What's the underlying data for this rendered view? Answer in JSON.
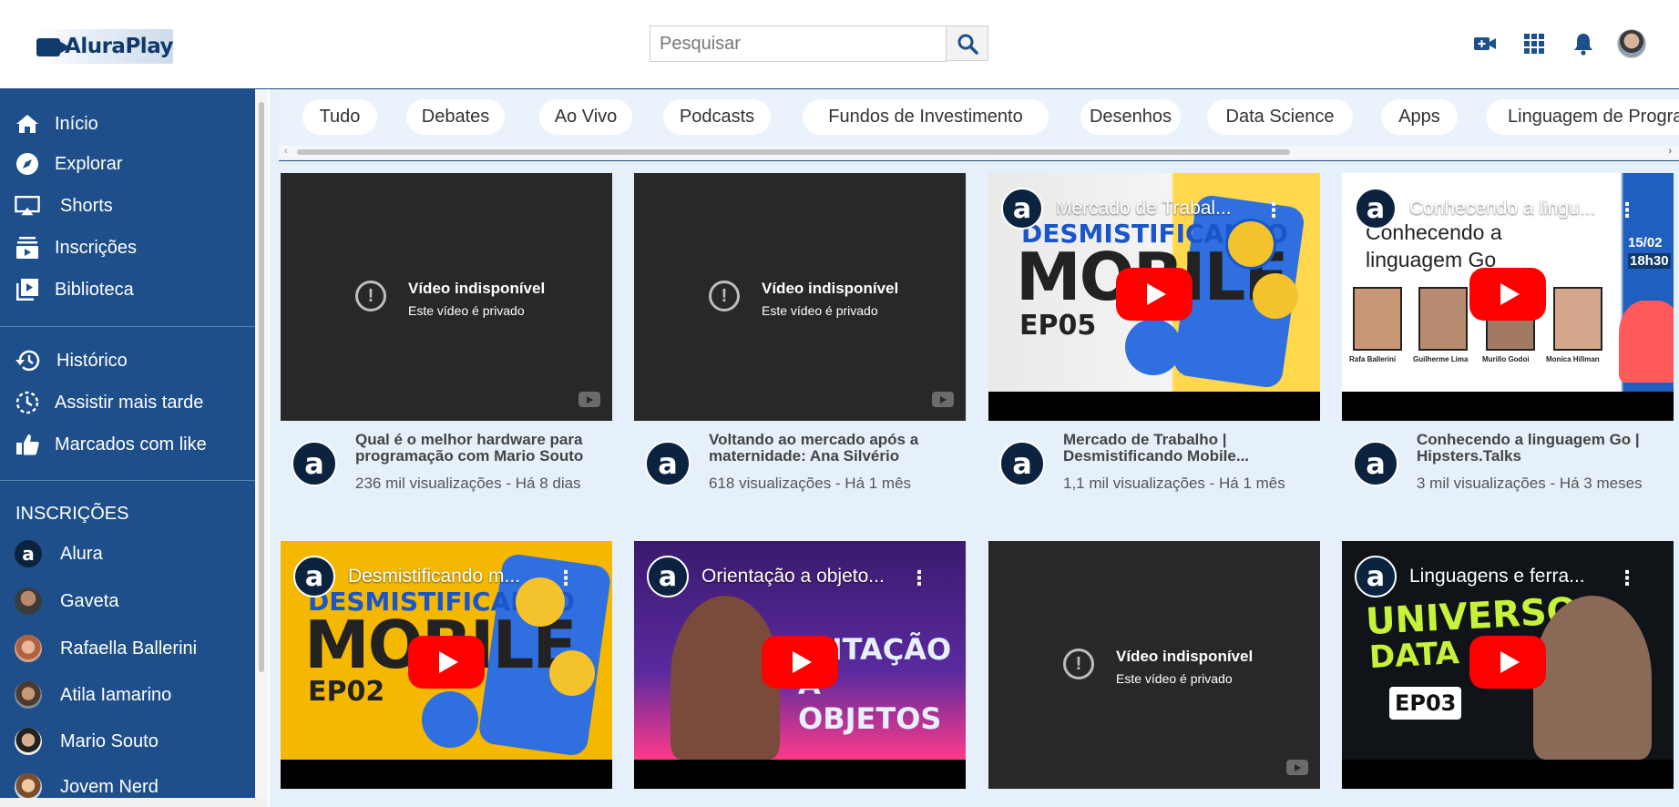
{
  "app": {
    "name": "AluraPlay"
  },
  "search": {
    "placeholder": "Pesquisar"
  },
  "header": {
    "icons": [
      "video-add-icon",
      "apps-grid-icon",
      "bell-icon",
      "user-avatar"
    ]
  },
  "sidebar": {
    "main_items": [
      {
        "label": "Início",
        "icon": "home-icon"
      },
      {
        "label": "Explorar",
        "icon": "compass-icon"
      },
      {
        "label": "Shorts",
        "icon": "shorts-icon"
      },
      {
        "label": "Inscrições",
        "icon": "subscriptions-icon"
      },
      {
        "label": "Biblioteca",
        "icon": "library-icon"
      }
    ],
    "secondary_items": [
      {
        "label": "Histórico",
        "icon": "history-icon"
      },
      {
        "label": "Assistir mais tarde",
        "icon": "watch-later-icon"
      },
      {
        "label": "Marcados com like",
        "icon": "thumbs-up-icon"
      }
    ],
    "subscriptions_heading": "INSCRIÇÕES",
    "subscriptions": [
      {
        "label": "Alura"
      },
      {
        "label": "Gaveta"
      },
      {
        "label": "Rafaella Ballerini"
      },
      {
        "label": "Atila Iamarino"
      },
      {
        "label": "Mario Souto"
      },
      {
        "label": "Jovem Nerd"
      }
    ]
  },
  "chips": [
    "Tudo",
    "Debates",
    "Ao Vivo",
    "Podcasts",
    "Fundos de Investimento",
    "Desenhos",
    "Data Science",
    "Apps",
    "Linguagem de Progra"
  ],
  "unavailable": {
    "title": "Vídeo indisponível",
    "subtitle": "Este vídeo é privado"
  },
  "videos": [
    {
      "title": "Qual é o melhor hardware para programação com Mario Souto",
      "meta": "236 mil visualizações - Há 8 dias",
      "embed_title": "",
      "available": false
    },
    {
      "title": "Voltando ao mercado após a maternidade: Ana Silvério",
      "meta": "618 visualizações - Há 1 mês",
      "embed_title": "",
      "available": false
    },
    {
      "title": "Mercado de Trabalho | Desmistificando Mobile...",
      "meta": "1,1 mil visualizações - Há 1 mês",
      "embed_title": "Mercado de Trabal...",
      "available": true
    },
    {
      "title": "Conhecendo a linguagem Go | Hipsters.Talks",
      "meta": "3 mil visualizações - Há 3 meses",
      "embed_title": "Conhecendo a lingu...",
      "available": true
    },
    {
      "title": "",
      "meta": "",
      "embed_title": "Desmistificando m...",
      "available": true
    },
    {
      "title": "",
      "meta": "",
      "embed_title": "Orientação a objeto...",
      "available": true
    },
    {
      "title": "",
      "meta": "",
      "embed_title": "",
      "available": false
    },
    {
      "title": "",
      "meta": "",
      "embed_title": "Linguagens e ferra...",
      "available": true
    }
  ],
  "thumb_text": {
    "v3_line1": "DESMISTIFICANDO",
    "v3_line2": "MOBILE",
    "v3_ep": "EP05",
    "v4_title": "Conhecendo a linguagem Go",
    "v4_date": "15/02",
    "v4_time": "18h30",
    "v4_people": [
      "Rafa Ballerini",
      "Guilherme Lima",
      "Murillo Godoi",
      "Monica Hillman"
    ],
    "v5_line1": "DESMISTIFICANDO",
    "v5_line2": "MOBILE",
    "v5_ep": "EP02",
    "v6_line1": "ENTAÇÃO",
    "v6_line2": "A OBJETOS",
    "v8_line1": "UNIVERSO",
    "v8_line2": "DATA SC",
    "v8_ep": "EP03"
  },
  "colors": {
    "sidebar": "#1e4f8a",
    "main_bg": "#e6f0fa",
    "play": "#ff0000",
    "accent": "#0f3a6b"
  }
}
